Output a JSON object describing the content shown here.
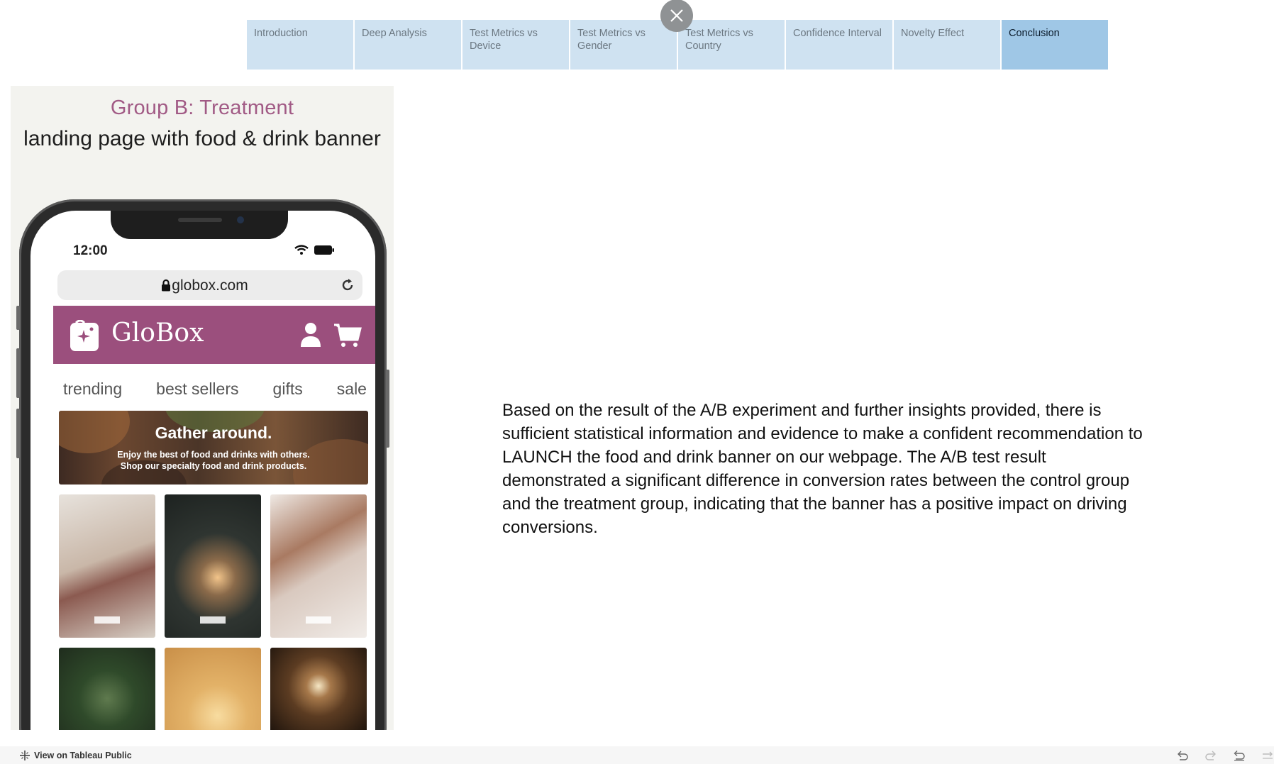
{
  "story_nav": {
    "tabs": [
      {
        "label": "Introduction",
        "active": false
      },
      {
        "label": "Deep Analysis",
        "active": false
      },
      {
        "label": "Test Metrics vs Device",
        "active": false
      },
      {
        "label": "Test Metrics vs Gender",
        "active": false
      },
      {
        "label": "Test Metrics vs Country",
        "active": false
      },
      {
        "label": "Confidence Interval",
        "active": false
      },
      {
        "label": "Novelty Effect",
        "active": false
      },
      {
        "label": "Conclusion",
        "active": true
      }
    ]
  },
  "image": {
    "group_title": "Group B: Treatment",
    "group_subtitle": "landing page with food & drink banner",
    "phone": {
      "time": "12:00",
      "url": "globox.com",
      "brand": "GloBox",
      "nav_items": [
        "trending",
        "best sellers",
        "gifts",
        "sale"
      ],
      "hero_title": "Gather around.",
      "hero_line1": "Enjoy the best of food and drinks with others.",
      "hero_line2": "Shop our specialty food and drink products."
    }
  },
  "conclusion": {
    "text": "Based on the result of the A/B experiment and further insights provided, there is sufficient statistical information and evidence to make a confident recommendation to LAUNCH the food and drink banner on our webpage. The A/B test result demonstrated a significant difference in conversion rates between the control group and the treatment group, indicating that the banner has a positive impact on driving conversions."
  },
  "footer": {
    "view_link": "View on Tableau Public"
  },
  "colors": {
    "tab_bg": "#cfe2f1",
    "tab_active_bg": "#9fc7e6",
    "brand_purple": "#9b4f7d",
    "title_purple": "#a15a85"
  },
  "icons": {
    "close": "close-icon",
    "footer": [
      "undo-icon",
      "redo-icon",
      "revert-icon",
      "pause-icon"
    ]
  }
}
